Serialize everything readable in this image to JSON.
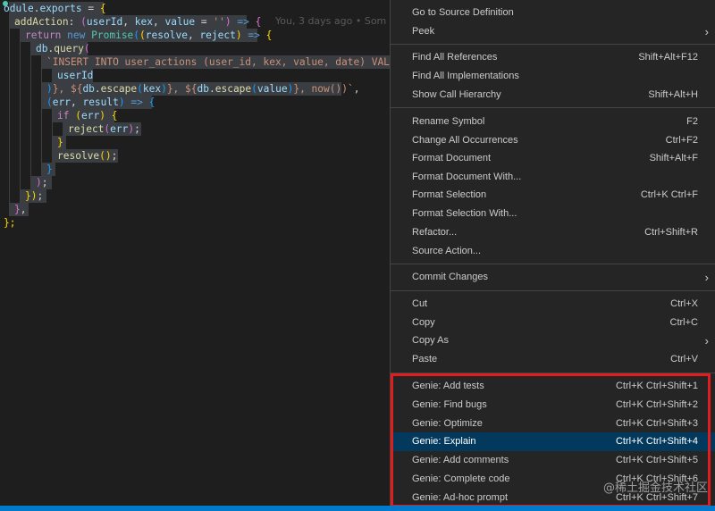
{
  "editor": {
    "blame": "You, 3 days ago • Som",
    "lines": {
      "l1": {
        "a": "odule",
        "b": ".",
        "c": "exports",
        "d": " = ",
        "e": "{"
      },
      "l2": {
        "a": "addAction",
        "b": ": ",
        "c": "(",
        "d": "userId",
        "e": ", ",
        "f": "kex",
        "g": ", ",
        "h": "value",
        "i": " = ",
        "j": "''",
        "k": ")",
        "l": " => ",
        "m": "{"
      },
      "l3": {
        "a": "return",
        "b": " ",
        "c": "new",
        "d": " ",
        "e": "Promise",
        "f": "(",
        "g": "(",
        "h": "resolve",
        "i": ", ",
        "j": "reject",
        "k": ")",
        "l": " => ",
        "m": "{"
      },
      "l4": {
        "a": "db",
        "b": ".",
        "c": "query",
        "d": "("
      },
      "l5": {
        "a": "`INSERT INTO user_actions (user_id, kex, value, date) VALUES ("
      },
      "l6": {
        "a": "userId"
      },
      "l7": {
        "a": ")",
        "b": "}, ${",
        "c": "db",
        "d": ".",
        "e": "escape",
        "f": "(",
        "g": "kex",
        "h": ")",
        "i": "}, ${",
        "j": "db",
        "k": ".",
        "l": "escape",
        "m": "(",
        "n": "value",
        "o": ")",
        "p": "}, now())`",
        "q": ","
      },
      "l8": {
        "a": "(",
        "b": "err",
        "c": ", ",
        "d": "result",
        "e": ")",
        "f": " => ",
        "g": "{"
      },
      "l9": {
        "a": "if",
        "b": " ",
        "c": "(",
        "d": "err",
        "e": ")",
        "f": " ",
        "g": "{"
      },
      "l10": {
        "a": "reject",
        "b": "(",
        "c": "err",
        "d": ")",
        "e": ";"
      },
      "l11": {
        "a": "}"
      },
      "l12": {
        "a": "resolve",
        "b": "()",
        "c": ";"
      },
      "l13": {
        "a": "}"
      },
      "l14": {
        "a": ")",
        "b": ";"
      },
      "l15": {
        "a": "})",
        "b": ";"
      },
      "l16": {
        "a": "}",
        "b": ","
      },
      "l17": {
        "a": "};"
      }
    }
  },
  "menu": {
    "go_to_source": {
      "label": "Go to Source Definition"
    },
    "peek": {
      "label": "Peek"
    },
    "find_all_refs": {
      "label": "Find All References",
      "kb": "Shift+Alt+F12"
    },
    "find_all_impls": {
      "label": "Find All Implementations"
    },
    "call_hierarchy": {
      "label": "Show Call Hierarchy",
      "kb": "Shift+Alt+H"
    },
    "rename_symbol": {
      "label": "Rename Symbol",
      "kb": "F2"
    },
    "change_all": {
      "label": "Change All Occurrences",
      "kb": "Ctrl+F2"
    },
    "format_doc": {
      "label": "Format Document",
      "kb": "Shift+Alt+F"
    },
    "format_doc_with": {
      "label": "Format Document With..."
    },
    "format_sel": {
      "label": "Format Selection",
      "kb": "Ctrl+K Ctrl+F"
    },
    "format_sel_with": {
      "label": "Format Selection With..."
    },
    "refactor": {
      "label": "Refactor...",
      "kb": "Ctrl+Shift+R"
    },
    "source_action": {
      "label": "Source Action..."
    },
    "commit_changes": {
      "label": "Commit Changes"
    },
    "cut": {
      "label": "Cut",
      "kb": "Ctrl+X"
    },
    "copy": {
      "label": "Copy",
      "kb": "Ctrl+C"
    },
    "copy_as": {
      "label": "Copy As"
    },
    "paste": {
      "label": "Paste",
      "kb": "Ctrl+V"
    },
    "genie_tests": {
      "label": "Genie: Add tests",
      "kb": "Ctrl+K Ctrl+Shift+1"
    },
    "genie_bugs": {
      "label": "Genie: Find bugs",
      "kb": "Ctrl+K Ctrl+Shift+2"
    },
    "genie_optimize": {
      "label": "Genie: Optimize",
      "kb": "Ctrl+K Ctrl+Shift+3"
    },
    "genie_explain": {
      "label": "Genie: Explain",
      "kb": "Ctrl+K Ctrl+Shift+4"
    },
    "genie_comments": {
      "label": "Genie: Add comments",
      "kb": "Ctrl+K Ctrl+Shift+5"
    },
    "genie_complete": {
      "label": "Genie: Complete code",
      "kb": "Ctrl+K Ctrl+Shift+6"
    },
    "genie_adhoc": {
      "label": "Genie: Ad-hoc prompt",
      "kb": "Ctrl+K Ctrl+Shift+7"
    }
  },
  "watermark": "@稀土掘金技术社区",
  "colors": {
    "highlight_border": "#e11d1d",
    "active_item": "#04395e",
    "status_bar": "#007acc"
  }
}
